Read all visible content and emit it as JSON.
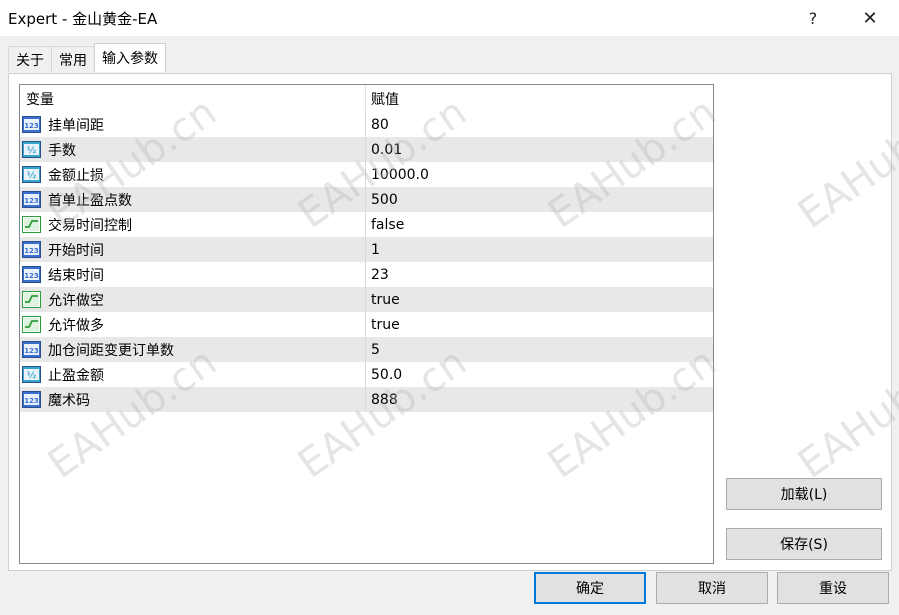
{
  "window": {
    "title": "Expert - 金山黄金-EA",
    "help_label": "?",
    "close_label": "✕"
  },
  "tabs": [
    {
      "label": "关于",
      "active": false
    },
    {
      "label": "常用",
      "active": false
    },
    {
      "label": "输入参数",
      "active": true
    }
  ],
  "table": {
    "headers": {
      "variable": "变量",
      "value": "赋值"
    },
    "rows": [
      {
        "icon": "int-icon",
        "name": "挂单间距",
        "value": "80"
      },
      {
        "icon": "double-icon",
        "name": "手数",
        "value": "0.01"
      },
      {
        "icon": "double-icon",
        "name": "金额止损",
        "value": "10000.0"
      },
      {
        "icon": "int-icon",
        "name": "首单止盈点数",
        "value": "500"
      },
      {
        "icon": "bool-icon",
        "name": "交易时间控制",
        "value": "false"
      },
      {
        "icon": "int-icon",
        "name": "开始时间",
        "value": "1"
      },
      {
        "icon": "int-icon",
        "name": "结束时间",
        "value": "23"
      },
      {
        "icon": "bool-icon",
        "name": "允许做空",
        "value": "true"
      },
      {
        "icon": "bool-icon",
        "name": "允许做多",
        "value": "true"
      },
      {
        "icon": "int-icon",
        "name": "加仓间距变更订单数",
        "value": "5"
      },
      {
        "icon": "double-icon",
        "name": "止盈金额",
        "value": "50.0"
      },
      {
        "icon": "int-icon",
        "name": "魔术码",
        "value": "888"
      }
    ]
  },
  "buttons": {
    "load": "加载(L)",
    "save": "保存(S)",
    "ok": "确定",
    "cancel": "取消",
    "reset": "重设"
  },
  "icon_text": {
    "int": "123",
    "double": "½"
  },
  "watermark": {
    "text": "EAHub.cn",
    "color": "#b4b4b4"
  },
  "colors": {
    "int_icon": "#3a6fd0",
    "double_icon": "#39a6c8",
    "bool_icon": "#2e9e3a",
    "focus_border": "#0078d7"
  }
}
